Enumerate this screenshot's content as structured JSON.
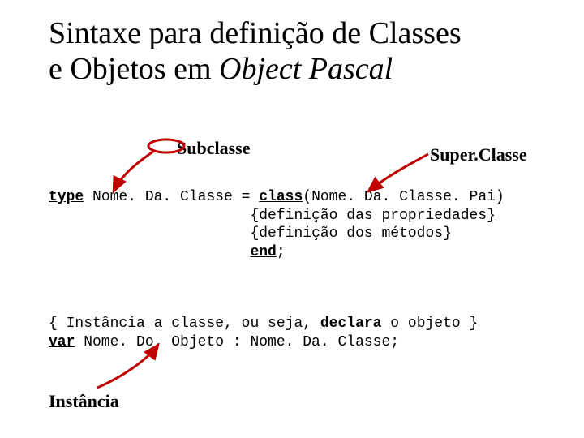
{
  "title": {
    "line1": "Sintaxe para definição de Classes",
    "line2_plain": "e Objetos em ",
    "line2_italic": "Object Pascal"
  },
  "labels": {
    "subclasse": "Subclasse",
    "superclasse": "Super.Classe",
    "instancia": "Instância"
  },
  "code1": {
    "kw_type": "type",
    "l1a": " Nome. Da. Classe = ",
    "kw_class": "class",
    "l1b": "(Nome. Da. Classe. Pai)",
    "indent": "                       ",
    "l2": "{definição das propriedades}",
    "l3": "{definição dos métodos}",
    "kw_end": "end",
    "semi": ";"
  },
  "code2": {
    "l1a": "{ Instância a classe, ou seja, ",
    "kw_declara": "declara",
    "l1b": " o objeto }",
    "kw_var": "var",
    "l2": " Nome. Do. Objeto : Nome. Da. Classe;"
  },
  "colors": {
    "arrow": "#c00000"
  }
}
